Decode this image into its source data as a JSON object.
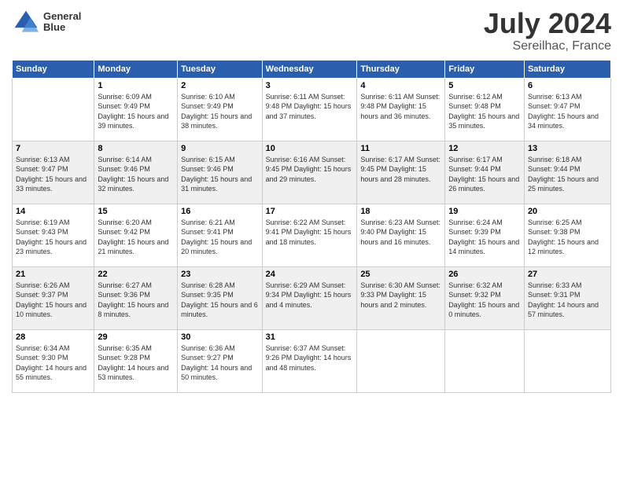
{
  "logo": {
    "line1": "General",
    "line2": "Blue"
  },
  "title": "July 2024",
  "subtitle": "Sereilhac, France",
  "header": {
    "days": [
      "Sunday",
      "Monday",
      "Tuesday",
      "Wednesday",
      "Thursday",
      "Friday",
      "Saturday"
    ]
  },
  "weeks": [
    [
      {
        "num": "",
        "info": ""
      },
      {
        "num": "1",
        "info": "Sunrise: 6:09 AM\nSunset: 9:49 PM\nDaylight: 15 hours\nand 39 minutes."
      },
      {
        "num": "2",
        "info": "Sunrise: 6:10 AM\nSunset: 9:49 PM\nDaylight: 15 hours\nand 38 minutes."
      },
      {
        "num": "3",
        "info": "Sunrise: 6:11 AM\nSunset: 9:48 PM\nDaylight: 15 hours\nand 37 minutes."
      },
      {
        "num": "4",
        "info": "Sunrise: 6:11 AM\nSunset: 9:48 PM\nDaylight: 15 hours\nand 36 minutes."
      },
      {
        "num": "5",
        "info": "Sunrise: 6:12 AM\nSunset: 9:48 PM\nDaylight: 15 hours\nand 35 minutes."
      },
      {
        "num": "6",
        "info": "Sunrise: 6:13 AM\nSunset: 9:47 PM\nDaylight: 15 hours\nand 34 minutes."
      }
    ],
    [
      {
        "num": "7",
        "info": "Sunrise: 6:13 AM\nSunset: 9:47 PM\nDaylight: 15 hours\nand 33 minutes."
      },
      {
        "num": "8",
        "info": "Sunrise: 6:14 AM\nSunset: 9:46 PM\nDaylight: 15 hours\nand 32 minutes."
      },
      {
        "num": "9",
        "info": "Sunrise: 6:15 AM\nSunset: 9:46 PM\nDaylight: 15 hours\nand 31 minutes."
      },
      {
        "num": "10",
        "info": "Sunrise: 6:16 AM\nSunset: 9:45 PM\nDaylight: 15 hours\nand 29 minutes."
      },
      {
        "num": "11",
        "info": "Sunrise: 6:17 AM\nSunset: 9:45 PM\nDaylight: 15 hours\nand 28 minutes."
      },
      {
        "num": "12",
        "info": "Sunrise: 6:17 AM\nSunset: 9:44 PM\nDaylight: 15 hours\nand 26 minutes."
      },
      {
        "num": "13",
        "info": "Sunrise: 6:18 AM\nSunset: 9:44 PM\nDaylight: 15 hours\nand 25 minutes."
      }
    ],
    [
      {
        "num": "14",
        "info": "Sunrise: 6:19 AM\nSunset: 9:43 PM\nDaylight: 15 hours\nand 23 minutes."
      },
      {
        "num": "15",
        "info": "Sunrise: 6:20 AM\nSunset: 9:42 PM\nDaylight: 15 hours\nand 21 minutes."
      },
      {
        "num": "16",
        "info": "Sunrise: 6:21 AM\nSunset: 9:41 PM\nDaylight: 15 hours\nand 20 minutes."
      },
      {
        "num": "17",
        "info": "Sunrise: 6:22 AM\nSunset: 9:41 PM\nDaylight: 15 hours\nand 18 minutes."
      },
      {
        "num": "18",
        "info": "Sunrise: 6:23 AM\nSunset: 9:40 PM\nDaylight: 15 hours\nand 16 minutes."
      },
      {
        "num": "19",
        "info": "Sunrise: 6:24 AM\nSunset: 9:39 PM\nDaylight: 15 hours\nand 14 minutes."
      },
      {
        "num": "20",
        "info": "Sunrise: 6:25 AM\nSunset: 9:38 PM\nDaylight: 15 hours\nand 12 minutes."
      }
    ],
    [
      {
        "num": "21",
        "info": "Sunrise: 6:26 AM\nSunset: 9:37 PM\nDaylight: 15 hours\nand 10 minutes."
      },
      {
        "num": "22",
        "info": "Sunrise: 6:27 AM\nSunset: 9:36 PM\nDaylight: 15 hours\nand 8 minutes."
      },
      {
        "num": "23",
        "info": "Sunrise: 6:28 AM\nSunset: 9:35 PM\nDaylight: 15 hours\nand 6 minutes."
      },
      {
        "num": "24",
        "info": "Sunrise: 6:29 AM\nSunset: 9:34 PM\nDaylight: 15 hours\nand 4 minutes."
      },
      {
        "num": "25",
        "info": "Sunrise: 6:30 AM\nSunset: 9:33 PM\nDaylight: 15 hours\nand 2 minutes."
      },
      {
        "num": "26",
        "info": "Sunrise: 6:32 AM\nSunset: 9:32 PM\nDaylight: 15 hours\nand 0 minutes."
      },
      {
        "num": "27",
        "info": "Sunrise: 6:33 AM\nSunset: 9:31 PM\nDaylight: 14 hours\nand 57 minutes."
      }
    ],
    [
      {
        "num": "28",
        "info": "Sunrise: 6:34 AM\nSunset: 9:30 PM\nDaylight: 14 hours\nand 55 minutes."
      },
      {
        "num": "29",
        "info": "Sunrise: 6:35 AM\nSunset: 9:28 PM\nDaylight: 14 hours\nand 53 minutes."
      },
      {
        "num": "30",
        "info": "Sunrise: 6:36 AM\nSunset: 9:27 PM\nDaylight: 14 hours\nand 50 minutes."
      },
      {
        "num": "31",
        "info": "Sunrise: 6:37 AM\nSunset: 9:26 PM\nDaylight: 14 hours\nand 48 minutes."
      },
      {
        "num": "",
        "info": ""
      },
      {
        "num": "",
        "info": ""
      },
      {
        "num": "",
        "info": ""
      }
    ]
  ]
}
